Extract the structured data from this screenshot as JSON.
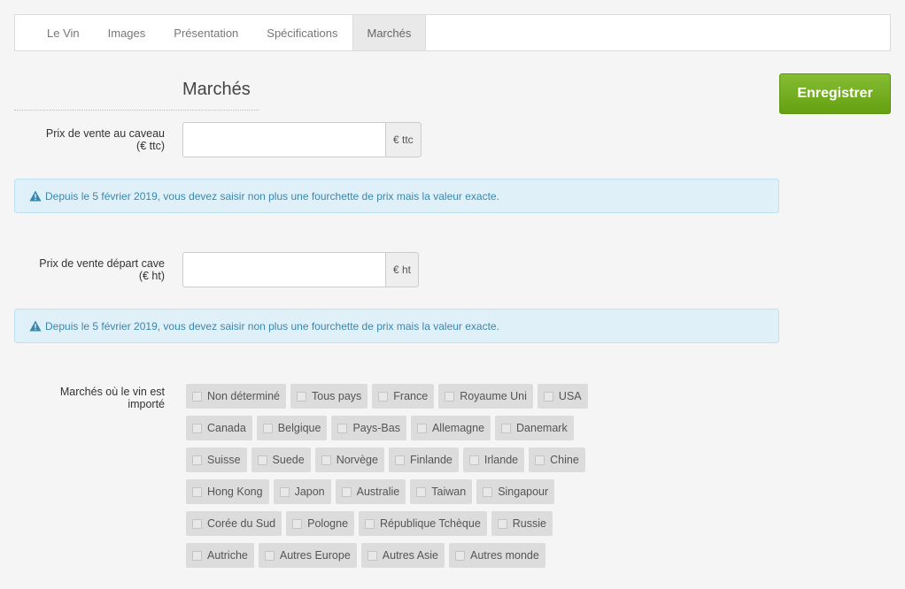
{
  "tabs": [
    {
      "label": "Le Vin"
    },
    {
      "label": "Images"
    },
    {
      "label": "Présentation"
    },
    {
      "label": "Spécifications"
    },
    {
      "label": "Marchés",
      "active": true
    }
  ],
  "section": {
    "title": "Marchés"
  },
  "save_button": {
    "label": "Enregistrer"
  },
  "colors": {
    "save_button": "#6aa717",
    "alert_text": "#3a87ad",
    "alert_bg": "#dff0f8"
  },
  "fields": {
    "caveau": {
      "label_line1": "Prix de vente au caveau",
      "label_line2": "(€ ttc)",
      "value": "",
      "addon": "€ ttc"
    },
    "depart": {
      "label_line1": "Prix de vente départ cave",
      "label_line2": "(€ ht)",
      "value": "",
      "addon": "€ ht"
    }
  },
  "alerts": {
    "caveau": "Depuis le 5 février 2019, vous devez saisir non plus une fourchette de prix mais la valeur exacte.",
    "depart": "Depuis le 5 février 2019, vous devez saisir non plus une fourchette de prix mais la valeur exacte.",
    "icon": "warning-icon"
  },
  "markets": {
    "label_line1": "Marchés où le vin est",
    "label_line2": "importé",
    "rows": [
      [
        "Non déterminé",
        "Tous pays",
        "France",
        "Royaume Uni",
        "USA"
      ],
      [
        "Canada",
        "Belgique",
        "Pays-Bas",
        "Allemagne",
        "Danemark"
      ],
      [
        "Suisse",
        "Suede",
        "Norvège",
        "Finlande",
        "Irlande",
        "Chine"
      ],
      [
        "Hong Kong",
        "Japon",
        "Australie",
        "Taiwan",
        "Singapour"
      ],
      [
        "Corée du Sud",
        "Pologne",
        "République Tchèque",
        "Russie"
      ],
      [
        "Autriche",
        "Autres Europe",
        "Autres Asie",
        "Autres monde"
      ]
    ]
  }
}
